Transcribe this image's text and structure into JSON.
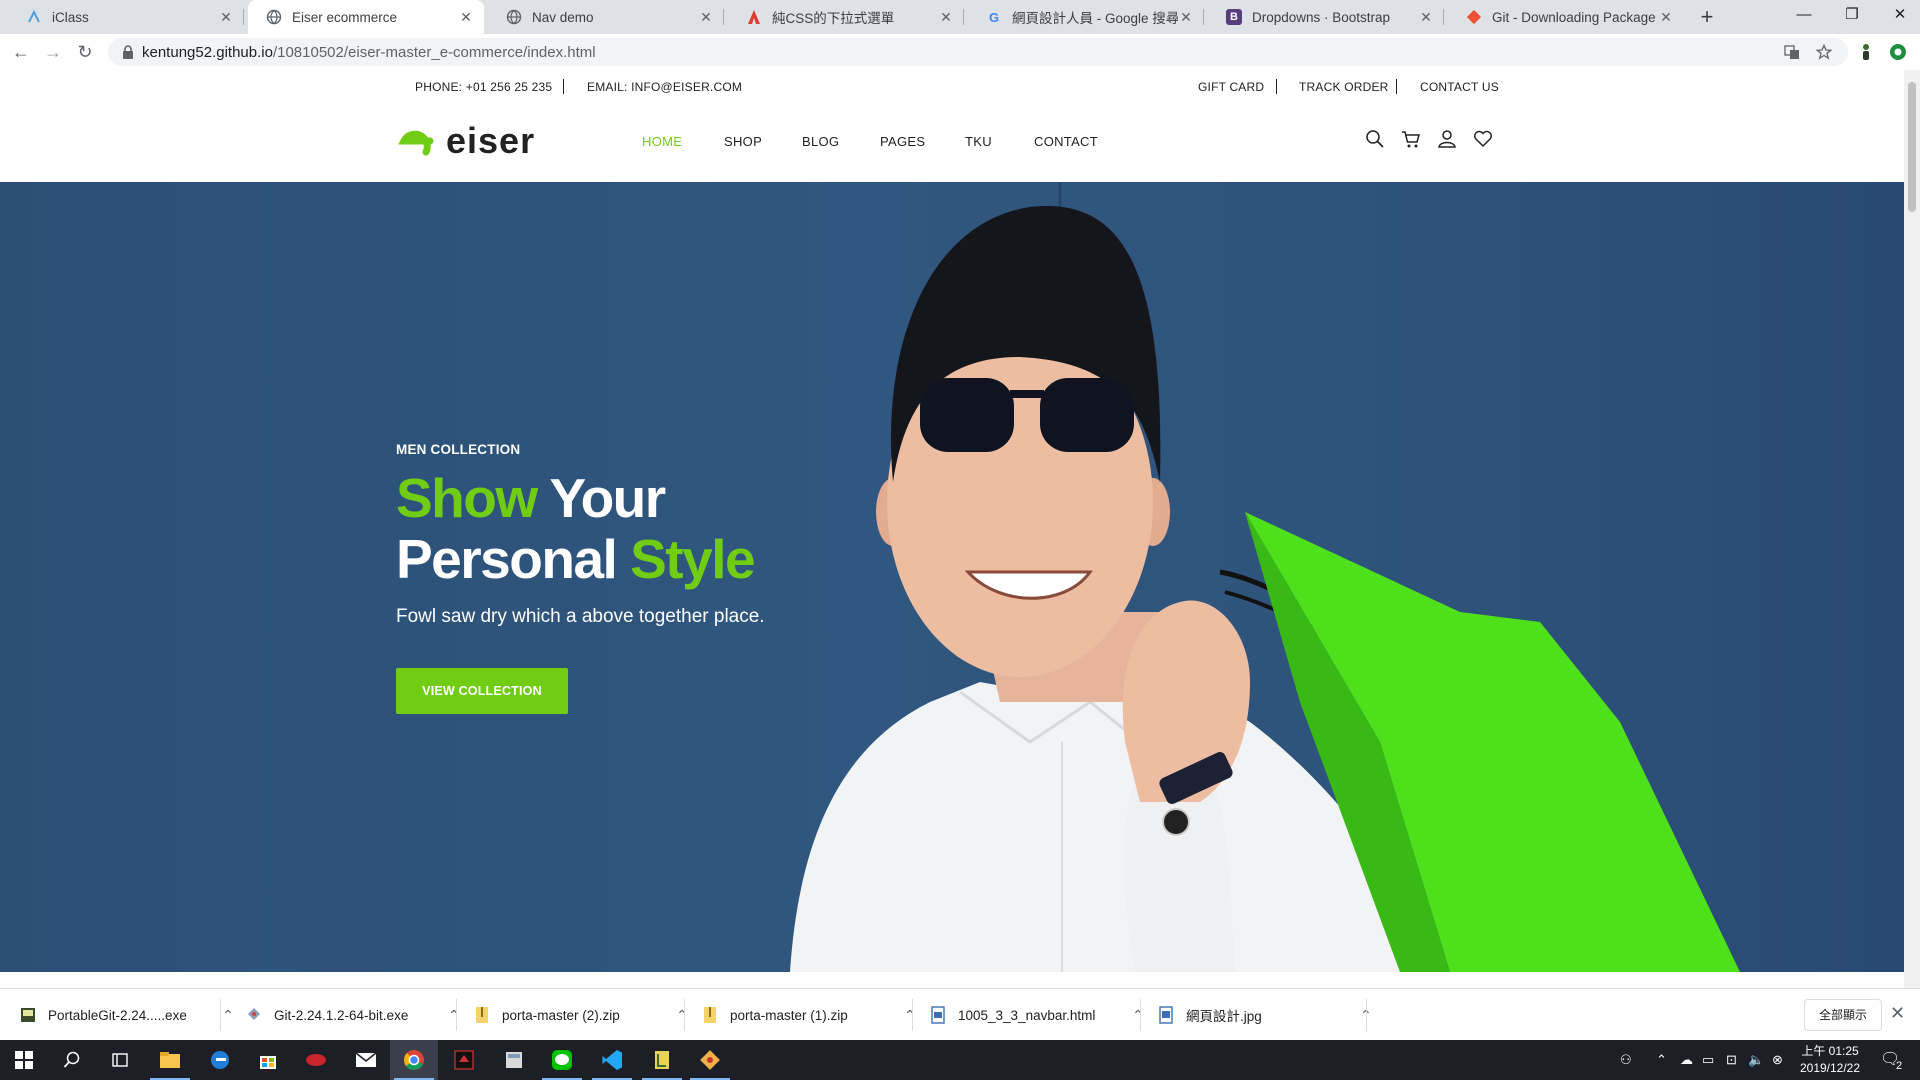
{
  "browser": {
    "tabs": [
      {
        "title": "iClass",
        "favicon": "iclass-icon",
        "active": false
      },
      {
        "title": "Eiser ecommerce",
        "favicon": "globe-icon",
        "active": true
      },
      {
        "title": "Nav demo",
        "favicon": "globe-icon",
        "active": false
      },
      {
        "title": "純CSS的下拉式選單",
        "favicon": "red-a-icon",
        "active": false
      },
      {
        "title": "網頁設計人員 - Google 搜尋",
        "favicon": "google-icon",
        "active": false
      },
      {
        "title": "Dropdowns · Bootstrap",
        "favicon": "bootstrap-icon",
        "active": false
      },
      {
        "title": "Git - Downloading Package",
        "favicon": "git-icon",
        "active": false
      }
    ],
    "url_host": "kentung52.github.io",
    "url_path": "/10810502/eiser-master_e-commerce/index.html"
  },
  "site": {
    "topbar": {
      "phone": "PHONE: +01 256 25 235",
      "email": "EMAIL: INFO@EISER.COM",
      "gift_card": "GIFT CARD",
      "track_order": "TRACK ORDER",
      "contact_us": "CONTACT US"
    },
    "logo_text": "eiser",
    "menu": [
      {
        "label": "HOME",
        "active": true
      },
      {
        "label": "SHOP",
        "active": false
      },
      {
        "label": "BLOG",
        "active": false
      },
      {
        "label": "PAGES",
        "active": false
      },
      {
        "label": "TKU",
        "active": false
      },
      {
        "label": "CONTACT",
        "active": false
      }
    ],
    "hero": {
      "eyebrow": "MEN COLLECTION",
      "headline_1a": "Show",
      "headline_1b": "Your",
      "headline_2a": "Personal",
      "headline_2b": "Style",
      "subline": "Fowl saw dry which a above together place.",
      "cta": "VIEW COLLECTION"
    },
    "accent_color": "#71cd14"
  },
  "downloads": {
    "items": [
      {
        "name": "PortableGit-2.24.....exe",
        "icon": "exe-icon"
      },
      {
        "name": "Git-2.24.1.2-64-bit.exe",
        "icon": "git-installer-icon"
      },
      {
        "name": "porta-master (2).zip",
        "icon": "zip-icon"
      },
      {
        "name": "porta-master (1).zip",
        "icon": "zip-icon"
      },
      {
        "name": "1005_3_3_navbar.html",
        "icon": "html-file-icon"
      },
      {
        "name": "網頁設計.jpg",
        "icon": "image-file-icon"
      }
    ],
    "show_all": "全部顯示"
  },
  "taskbar": {
    "clock_time": "上午 01:25",
    "clock_date": "2019/12/22",
    "notification_count": "2"
  }
}
